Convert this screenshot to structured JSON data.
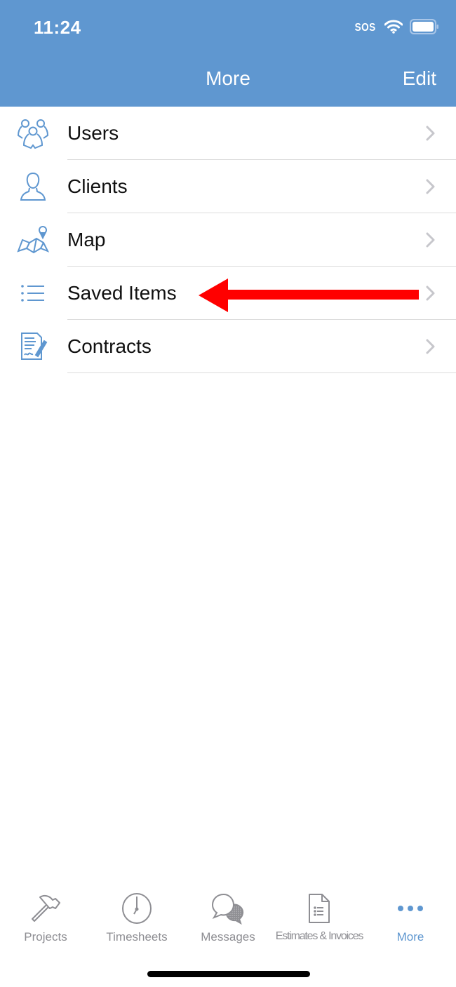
{
  "status_bar": {
    "time": "11:24",
    "carrier": "SOS",
    "wifi_icon": "wifi-icon",
    "battery_icon": "battery-icon"
  },
  "nav": {
    "title": "More",
    "edit_label": "Edit"
  },
  "colors": {
    "accent": "#5f97d0",
    "annotation_arrow": "#ff0000",
    "inactive_tab": "#8e8e93",
    "chevron": "#c7c7cc",
    "separator": "#dcdcdc"
  },
  "menu": {
    "items": [
      {
        "label": "Users",
        "icon": "users-icon"
      },
      {
        "label": "Clients",
        "icon": "client-icon"
      },
      {
        "label": "Map",
        "icon": "map-icon"
      },
      {
        "label": "Saved Items",
        "icon": "list-icon"
      },
      {
        "label": "Contracts",
        "icon": "contract-icon"
      }
    ]
  },
  "annotation": {
    "type": "arrow",
    "points_to": "Saved Items"
  },
  "tabbar": {
    "tabs": [
      {
        "label": "Projects",
        "icon": "hammer-icon",
        "active": false
      },
      {
        "label": "Timesheets",
        "icon": "clock-icon",
        "active": false
      },
      {
        "label": "Messages",
        "icon": "chat-bubbles-icon",
        "active": false
      },
      {
        "label": "Estimates & Invoices",
        "icon": "document-icon",
        "active": false
      },
      {
        "label": "More",
        "icon": "more-dots-icon",
        "active": true
      }
    ]
  }
}
